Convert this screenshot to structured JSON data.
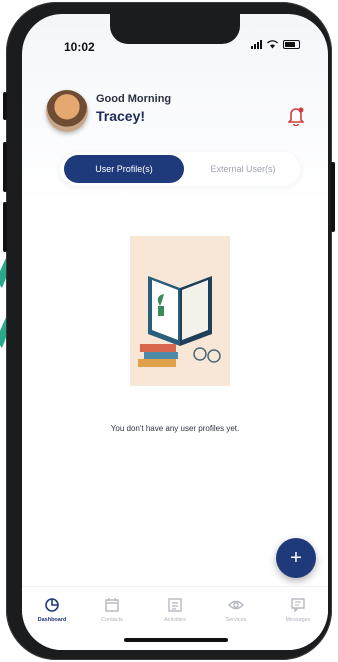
{
  "status_bar": {
    "time": "10:02"
  },
  "header": {
    "greeting": "Good Morning",
    "name": "Tracey!"
  },
  "segment": {
    "active_label": "User Profile(s)",
    "inactive_label": "External User(s)"
  },
  "empty_state": {
    "message": "You don't have any user profiles yet."
  },
  "fab": {
    "label": "+"
  },
  "tabs": [
    {
      "label": "Dashboard",
      "icon": "dashboard-icon"
    },
    {
      "label": "Contacts",
      "icon": "calendar-icon"
    },
    {
      "label": "Activities",
      "icon": "list-icon"
    },
    {
      "label": "Services",
      "icon": "eye-icon"
    },
    {
      "label": "Messages",
      "icon": "chat-icon"
    }
  ],
  "colors": {
    "accent": "#1f3a7a",
    "inactive": "#b0b4be",
    "bell": "#d33c3c"
  }
}
